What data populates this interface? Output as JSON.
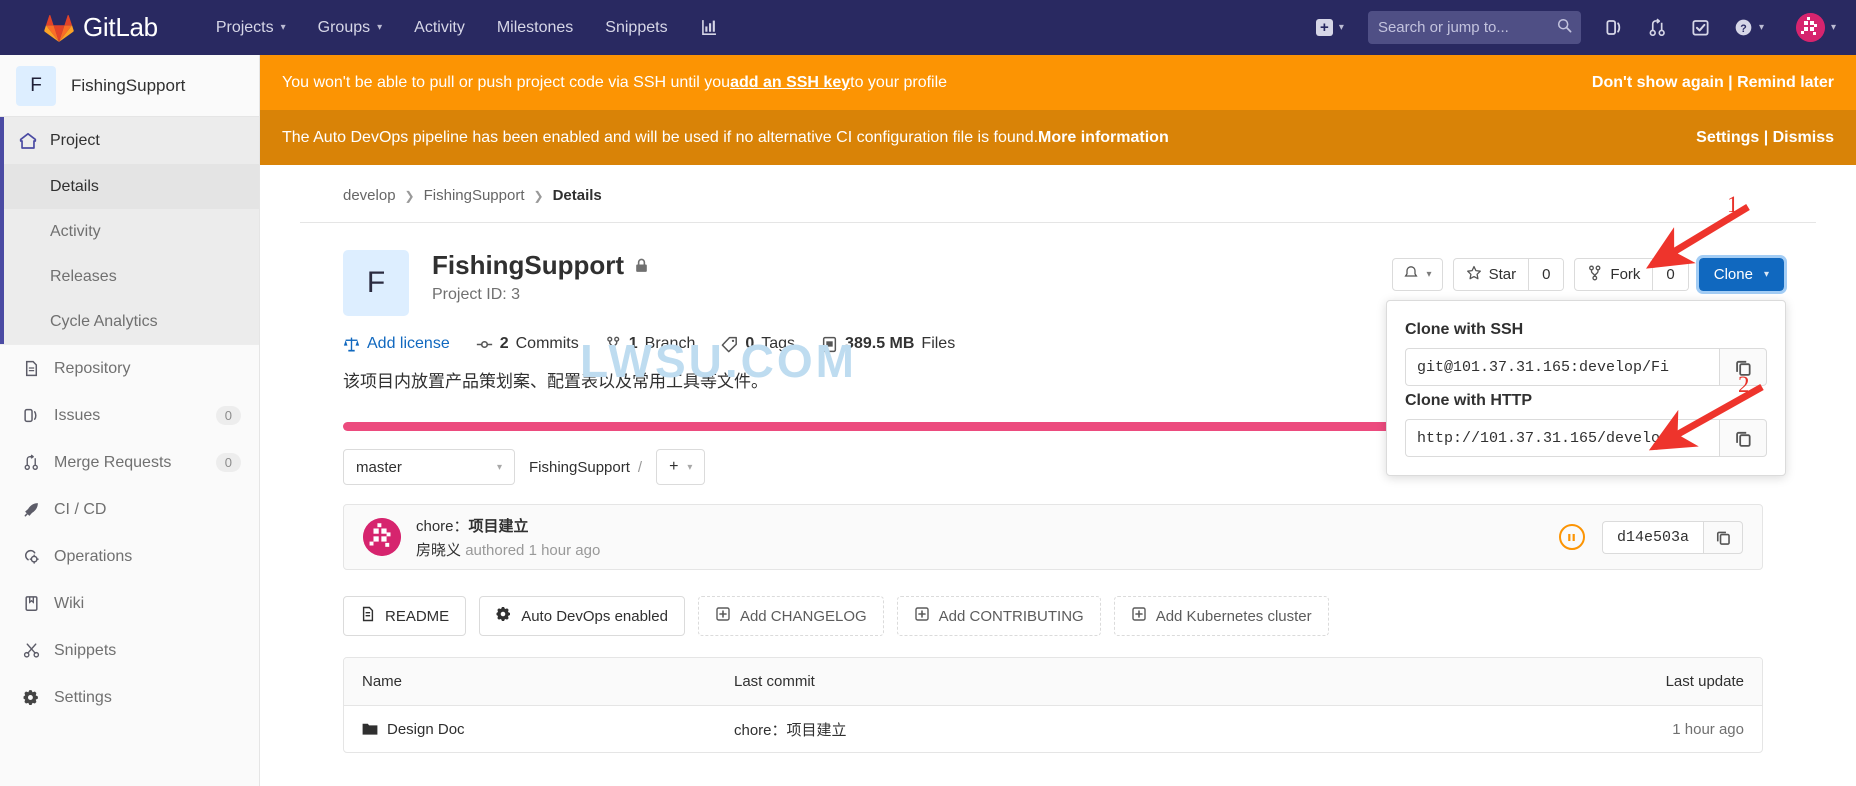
{
  "navbar": {
    "brand": "GitLab",
    "links": [
      {
        "label": "Projects",
        "caret": true,
        "name": "nav-projects"
      },
      {
        "label": "Groups",
        "caret": true,
        "name": "nav-groups"
      },
      {
        "label": "Activity",
        "caret": false,
        "name": "nav-activity"
      },
      {
        "label": "Milestones",
        "caret": false,
        "name": "nav-milestones"
      },
      {
        "label": "Snippets",
        "caret": false,
        "name": "nav-snippets"
      }
    ],
    "chart_icon": "chart-icon",
    "plus_label": "+",
    "search_placeholder": "Search or jump to...",
    "search_value": "",
    "icons": [
      "issues-icon",
      "merge-requests-icon",
      "todos-icon",
      "help-icon"
    ],
    "avatar": "user-avatar"
  },
  "sidebar": {
    "project_initial": "F",
    "project_name": "FishingSupport",
    "group_label": "Project",
    "sub_items": [
      {
        "label": "Details",
        "active": true
      },
      {
        "label": "Activity",
        "active": false
      },
      {
        "label": "Releases",
        "active": false
      },
      {
        "label": "Cycle Analytics",
        "active": false
      }
    ],
    "items": [
      {
        "label": "Repository",
        "icon": "repository-icon",
        "count": ""
      },
      {
        "label": "Issues",
        "icon": "issues-icon",
        "count": "0"
      },
      {
        "label": "Merge Requests",
        "icon": "merge-requests-icon",
        "count": "0"
      },
      {
        "label": "CI / CD",
        "icon": "rocket-icon",
        "count": ""
      },
      {
        "label": "Operations",
        "icon": "operations-icon",
        "count": ""
      },
      {
        "label": "Wiki",
        "icon": "book-icon",
        "count": ""
      },
      {
        "label": "Snippets",
        "icon": "scissors-icon",
        "count": ""
      },
      {
        "label": "Settings",
        "icon": "gear-icon",
        "count": ""
      }
    ]
  },
  "alerts": [
    {
      "text_before": "You won't be able to pull or push project code via SSH until you ",
      "link": "add an SSH key",
      "text_after": " to your profile",
      "actions": "Don't show again | Remind later",
      "color": "#fc9403"
    },
    {
      "text_before": "The Auto DevOps pipeline has been enabled and will be used if no alternative CI configuration file is found. ",
      "link": "More information",
      "text_after": "",
      "actions": "Settings | Dismiss",
      "color": "#d98307"
    }
  ],
  "breadcrumb": [
    {
      "label": "develop",
      "current": false
    },
    {
      "label": "FishingSupport",
      "current": false
    },
    {
      "label": "Details",
      "current": true
    }
  ],
  "project": {
    "initial": "F",
    "title": "FishingSupport",
    "visibility_icon": "lock-icon",
    "project_id": "Project ID: 3",
    "description": "该项目内放置产品策划案、配置表以及常用工具等文件。",
    "meta": [
      {
        "icon": "license-icon",
        "bold": "",
        "label": "Add license",
        "link": true
      },
      {
        "icon": "commit-icon",
        "bold": "2",
        "label": "Commits",
        "link": false
      },
      {
        "icon": "branch-icon",
        "bold": "1",
        "label": "Branch",
        "link": false
      },
      {
        "icon": "tag-icon",
        "bold": "0",
        "label": "Tags",
        "link": false
      },
      {
        "icon": "files-icon",
        "bold": "389.5 MB",
        "label": "Files",
        "link": false
      }
    ]
  },
  "actions": {
    "notification_icon": "bell-icon",
    "star_label": "Star",
    "star_count": "0",
    "star_icon": "star-icon",
    "fork_label": "Fork",
    "fork_count": "0",
    "fork_icon": "fork-icon",
    "clone_label": "Clone"
  },
  "clone_panel": {
    "ssh_label": "Clone with SSH",
    "ssh_value": "git@101.37.31.165:develop/Fi",
    "http_label": "Clone with HTTP",
    "http_value": "http://101.37.31.165/develop",
    "copy_icon": "copy-icon"
  },
  "language_bar": [
    {
      "name": "pink-segment",
      "color": "#ec4b7e",
      "pct": 80.5
    },
    {
      "name": "green-segment",
      "color": "#138808",
      "pct": 5.5
    },
    {
      "name": "empty-segment",
      "color": "#ffffff",
      "pct": 14.0
    }
  ],
  "branch_row": {
    "branch": "master",
    "repo_path": "FishingSupport",
    "slash": "/",
    "add_label": "+"
  },
  "commit": {
    "prefix": "chore：",
    "message": "项目建立",
    "author": "房晓义",
    "meta": "authored 1 hour ago",
    "status_icon": "pipeline-pending-icon",
    "sha": "d14e503a",
    "copy_icon": "copy-icon"
  },
  "quick_buttons": [
    {
      "label": "README",
      "icon": "readme-icon",
      "dashed": false
    },
    {
      "label": "Auto DevOps enabled",
      "icon": "gear-icon",
      "dashed": false
    },
    {
      "label": "Add CHANGELOG",
      "icon": "plus-square-icon",
      "dashed": true
    },
    {
      "label": "Add CONTRIBUTING",
      "icon": "plus-square-icon",
      "dashed": true
    },
    {
      "label": "Add Kubernetes cluster",
      "icon": "plus-square-icon",
      "dashed": true
    }
  ],
  "file_table": {
    "headers": {
      "name": "Name",
      "commit": "Last commit",
      "update": "Last update"
    },
    "rows": [
      {
        "name": "Design Doc",
        "icon": "folder-icon",
        "commit": "chore：项目建立",
        "update": "1 hour ago"
      }
    ]
  },
  "watermark": "LWSU.COM",
  "annotations": [
    {
      "number": "1",
      "target": "clone-button"
    },
    {
      "number": "2",
      "target": "http-copy-button"
    }
  ]
}
